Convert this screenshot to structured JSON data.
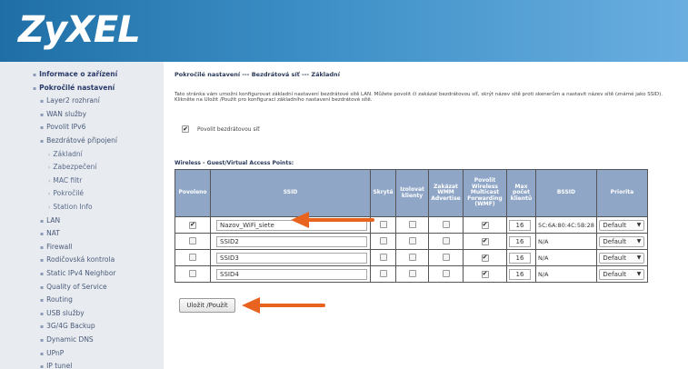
{
  "header": {
    "logo": "ZyXEL"
  },
  "sidebar": {
    "items": [
      {
        "label": "Informace o zařízení",
        "level": 1
      },
      {
        "label": "Pokročilé nastavení",
        "level": 1
      },
      {
        "label": "Layer2 rozhraní",
        "level": 2
      },
      {
        "label": "WAN služby",
        "level": 2
      },
      {
        "label": "Povolit IPv6",
        "level": 2
      },
      {
        "label": "Bezdrátové připojení",
        "level": 2
      },
      {
        "label": "Základní",
        "level": 3
      },
      {
        "label": "Zabezpečení",
        "level": 3
      },
      {
        "label": "MAC filtr",
        "level": 3
      },
      {
        "label": "Pokročilé",
        "level": 3
      },
      {
        "label": "Station Info",
        "level": 3
      },
      {
        "label": "LAN",
        "level": 2
      },
      {
        "label": "NAT",
        "level": 2
      },
      {
        "label": "Firewall",
        "level": 2
      },
      {
        "label": "Rodičovská kontrola",
        "level": 2
      },
      {
        "label": "Static IPv4 Neighbor",
        "level": 2
      },
      {
        "label": "Quality of Service",
        "level": 2
      },
      {
        "label": "Routing",
        "level": 2
      },
      {
        "label": "USB služby",
        "level": 2
      },
      {
        "label": "3G/4G Backup",
        "level": 2
      },
      {
        "label": "Dynamic DNS",
        "level": 2
      },
      {
        "label": "UPnP",
        "level": 2
      },
      {
        "label": "IP tunel",
        "level": 2
      }
    ]
  },
  "main": {
    "title": "Pokročilé nastavení --- Bezdrátová síť --- Základní",
    "description": "Tato stránka vám umožní konfigurovat základní nastavení bezdrátové sítě LAN. Můžete povolit či zakázat bezdrátovou síť, skrýt název sítě proti skenerům a nastavit název sítě (známé jako SSID). Klikněte na Uložit /Použít pro konfiguraci základního nastavení bezdrátové sítě.",
    "enable_label": "Povolit bezdrátovou síť",
    "enable_checked": true,
    "section_title": "Wireless - Guest/Virtual Access Points:",
    "columns": [
      "Povoleno",
      "SSID",
      "Skrytá",
      "Izolovat klienty",
      "Zakázat WMM Advertise",
      "Povolit Wireless Multicast Forwarding (WMF)",
      "Max počet klientů",
      "BSSID",
      "Priorita"
    ],
    "rows": [
      {
        "enabled": true,
        "ssid": "Nazov_WiFi_siete",
        "hidden": false,
        "isolate": false,
        "wmm": false,
        "wmf": true,
        "max": "16",
        "bssid": "5C:6A:80:4C:5B:28",
        "priority": "Default"
      },
      {
        "enabled": false,
        "ssid": "SSID2",
        "hidden": false,
        "isolate": false,
        "wmm": false,
        "wmf": true,
        "max": "16",
        "bssid": "N/A",
        "priority": "Default"
      },
      {
        "enabled": false,
        "ssid": "SSID3",
        "hidden": false,
        "isolate": false,
        "wmm": false,
        "wmf": true,
        "max": "16",
        "bssid": "N/A",
        "priority": "Default"
      },
      {
        "enabled": false,
        "ssid": "SSID4",
        "hidden": false,
        "isolate": false,
        "wmm": false,
        "wmf": true,
        "max": "16",
        "bssid": "N/A",
        "priority": "Default"
      }
    ],
    "save_label": "Uložit /Použít"
  },
  "colors": {
    "header": "#2b7cb8",
    "sidebar": "#e8ecf0",
    "table_header": "#8fa6c7",
    "annotation_arrow": "#e8641e"
  }
}
